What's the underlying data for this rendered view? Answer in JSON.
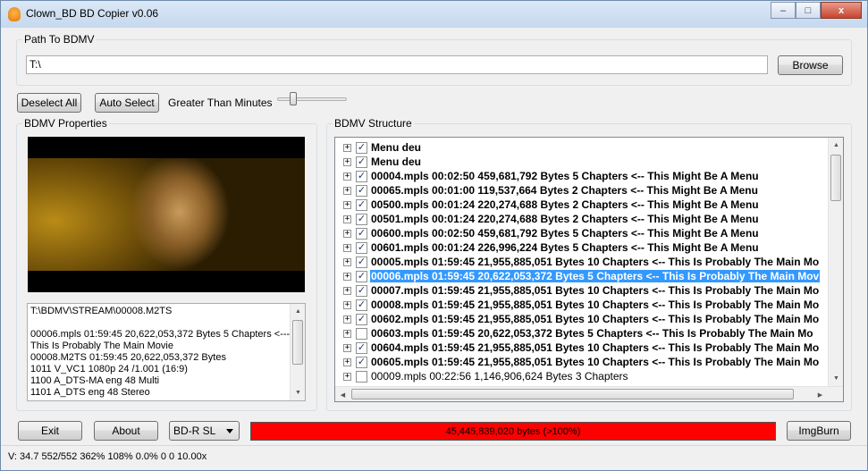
{
  "window": {
    "title": "Clown_BD BD Copier v0.06",
    "minimize": "–",
    "maximize": "□",
    "close": "x"
  },
  "path": {
    "group_title": "Path To BDMV",
    "value": "T:\\",
    "browse_label": "Browse"
  },
  "controls": {
    "deselect_all": "Deselect All",
    "auto_select": "Auto Select",
    "greater_than_minutes": "Greater Than Minutes",
    "slider_value": 0.2
  },
  "properties": {
    "group_title": "BDMV Properties",
    "info_lines": [
      "T:\\BDMV\\STREAM\\00008.M2TS",
      "",
      "00006.mpls 01:59:45 20,622,053,372 Bytes 5 Chapters <---",
      "This Is Probably The Main Movie",
      "00008.M2TS 01:59:45 20,622,053,372 Bytes",
      "1011 V_VC1  1080p 24 /1.001 (16:9)",
      "1100 A_DTS-MA eng 48 Multi",
      "1101 A_DTS eng 48 Stereo"
    ]
  },
  "structure": {
    "group_title": "BDMV Structure",
    "rows": [
      {
        "text": "Menu deu",
        "checked": true,
        "bold": true,
        "selected": false
      },
      {
        "text": "Menu deu",
        "checked": true,
        "bold": true,
        "selected": false
      },
      {
        "text": "00004.mpls 00:02:50 459,681,792 Bytes 5 Chapters <-- This Might Be A Menu",
        "checked": true,
        "bold": true,
        "selected": false
      },
      {
        "text": "00065.mpls 00:01:00 119,537,664 Bytes 2 Chapters <-- This Might Be A Menu",
        "checked": true,
        "bold": true,
        "selected": false
      },
      {
        "text": "00500.mpls 00:01:24 220,274,688 Bytes 2 Chapters <-- This Might Be A Menu",
        "checked": true,
        "bold": true,
        "selected": false
      },
      {
        "text": "00501.mpls 00:01:24 220,274,688 Bytes 2 Chapters <-- This Might Be A Menu",
        "checked": true,
        "bold": true,
        "selected": false
      },
      {
        "text": "00600.mpls 00:02:50 459,681,792 Bytes 5 Chapters <-- This Might Be A Menu",
        "checked": true,
        "bold": true,
        "selected": false
      },
      {
        "text": "00601.mpls 00:01:24 226,996,224 Bytes 5 Chapters <-- This Might Be A Menu",
        "checked": true,
        "bold": true,
        "selected": false
      },
      {
        "text": "00005.mpls 01:59:45 21,955,885,051 Bytes 10 Chapters <-- This Is Probably The Main Mo",
        "checked": true,
        "bold": true,
        "selected": false
      },
      {
        "text": "00006.mpls 01:59:45 20,622,053,372 Bytes 5 Chapters <-- This Is Probably The Main Mov",
        "checked": true,
        "bold": true,
        "selected": true
      },
      {
        "text": "00007.mpls 01:59:45 21,955,885,051 Bytes 10 Chapters <-- This Is Probably The Main Mo",
        "checked": true,
        "bold": true,
        "selected": false
      },
      {
        "text": "00008.mpls 01:59:45 21,955,885,051 Bytes 10 Chapters <-- This Is Probably The Main Mo",
        "checked": true,
        "bold": true,
        "selected": false
      },
      {
        "text": "00602.mpls 01:59:45 21,955,885,051 Bytes 10 Chapters <-- This Is Probably The Main Mo",
        "checked": true,
        "bold": true,
        "selected": false
      },
      {
        "text": "00603.mpls 01:59:45 20,622,053,372 Bytes 5 Chapters <-- This Is Probably The Main Mo",
        "checked": false,
        "bold": true,
        "selected": false
      },
      {
        "text": "00604.mpls 01:59:45 21,955,885,051 Bytes 10 Chapters <-- This Is Probably The Main Mo",
        "checked": true,
        "bold": true,
        "selected": false
      },
      {
        "text": "00605.mpls 01:59:45 21,955,885,051 Bytes 10 Chapters <-- This Is Probably The Main Mo",
        "checked": true,
        "bold": true,
        "selected": false
      },
      {
        "text": "00009.mpls 00:22:56 1,146,906,624 Bytes 3 Chapters",
        "checked": false,
        "bold": false,
        "selected": false
      }
    ]
  },
  "bottom": {
    "exit_label": "Exit",
    "about_label": "About",
    "disc_type": "BD-R SL",
    "progress_text": "45,445,839,020 bytes (>100%)",
    "progress_fraction": 1.0,
    "progress_color": "#ff0000",
    "imgburn_label": "ImgBurn"
  },
  "status": {
    "text": "V:  34.7 552/552 362% 108%  0.0% 0 0 10.00x"
  }
}
